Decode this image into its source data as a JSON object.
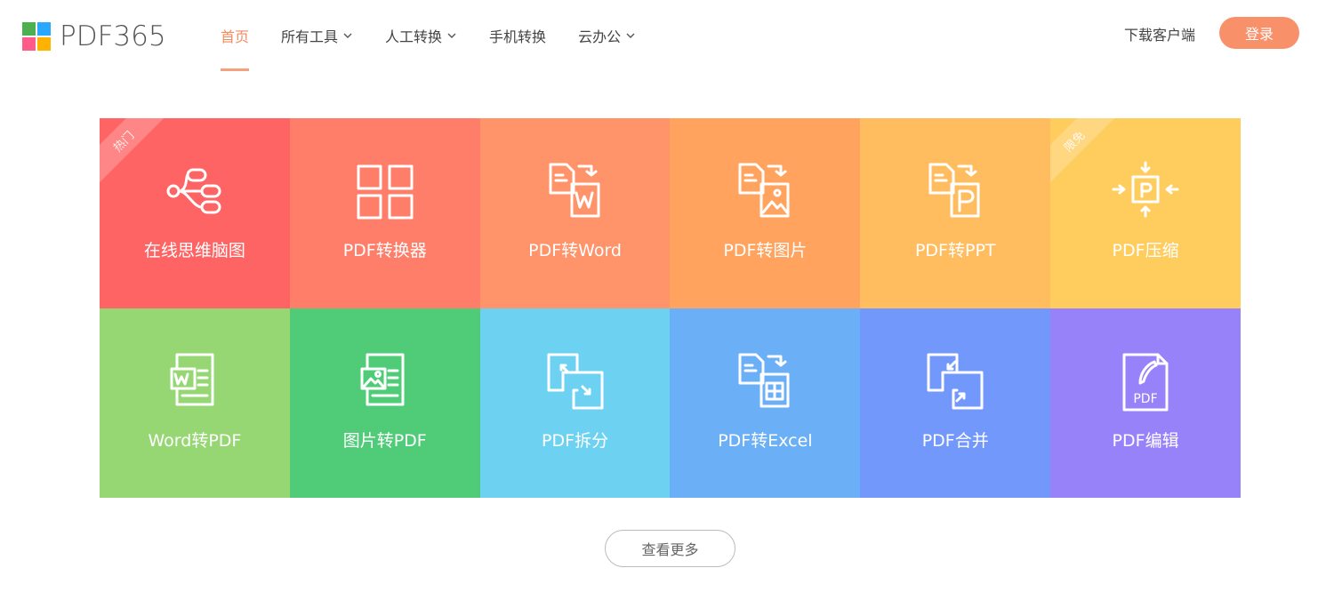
{
  "logo": {
    "text": "PDF365",
    "colors": [
      "#4caf50",
      "#29a8ff",
      "#ff5c8a",
      "#ffb300"
    ]
  },
  "nav": [
    {
      "label": "首页",
      "active": true,
      "dropdown": false
    },
    {
      "label": "所有工具",
      "active": false,
      "dropdown": true
    },
    {
      "label": "人工转换",
      "active": false,
      "dropdown": true
    },
    {
      "label": "手机转换",
      "active": false,
      "dropdown": false
    },
    {
      "label": "云办公",
      "active": false,
      "dropdown": true
    }
  ],
  "header": {
    "download_label": "下载客户端",
    "login_label": "登录"
  },
  "tiles": [
    {
      "label": "在线思维脑图",
      "icon": "mindmap-icon",
      "color": "#ff6464",
      "ribbon": "热门"
    },
    {
      "label": "PDF转换器",
      "icon": "grid-icon",
      "color": "#ff7e6a",
      "ribbon": ""
    },
    {
      "label": "PDF转Word",
      "icon": "pdf-to-word-icon",
      "color": "#ff936a",
      "ribbon": ""
    },
    {
      "label": "PDF转图片",
      "icon": "pdf-to-image-icon",
      "color": "#ffa35e",
      "ribbon": ""
    },
    {
      "label": "PDF转PPT",
      "icon": "pdf-to-ppt-icon",
      "color": "#ffbd60",
      "ribbon": ""
    },
    {
      "label": "PDF压缩",
      "icon": "compress-icon",
      "color": "#ffcc5e",
      "ribbon": "限免"
    },
    {
      "label": "Word转PDF",
      "icon": "word-to-pdf-icon",
      "color": "#96d774",
      "ribbon": ""
    },
    {
      "label": "图片转PDF",
      "icon": "image-to-pdf-icon",
      "color": "#50cc78",
      "ribbon": ""
    },
    {
      "label": "PDF拆分",
      "icon": "split-icon",
      "color": "#6dd2f2",
      "ribbon": ""
    },
    {
      "label": "PDF转Excel",
      "icon": "pdf-to-excel-icon",
      "color": "#6bb0f6",
      "ribbon": ""
    },
    {
      "label": "PDF合并",
      "icon": "merge-icon",
      "color": "#7398fb",
      "ribbon": ""
    },
    {
      "label": "PDF编辑",
      "icon": "pdf-edit-icon",
      "color": "#9882fa",
      "ribbon": ""
    }
  ],
  "more_label": "查看更多"
}
